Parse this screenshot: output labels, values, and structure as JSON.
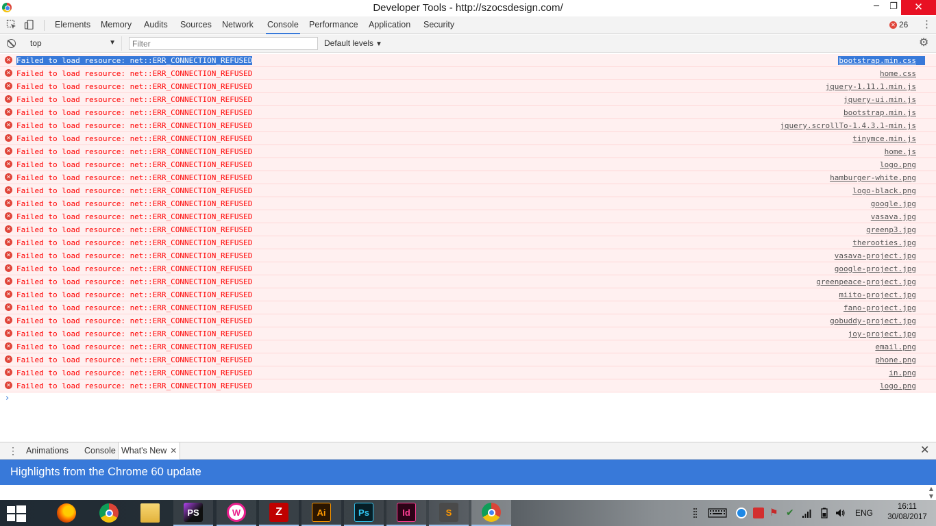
{
  "window": {
    "title": "Developer Tools - http://szocsdesign.com/",
    "min_glyph": "─",
    "max_glyph": "❐",
    "close_glyph": "✕"
  },
  "tabs": [
    "Elements",
    "Memory",
    "Audits",
    "Sources",
    "Network",
    "Console",
    "Performance",
    "Application",
    "Security"
  ],
  "active_tab": "Console",
  "error_count": "26",
  "filterbar": {
    "context": "top",
    "filter_placeholder": "Filter",
    "levels": "Default levels"
  },
  "messages": [
    {
      "text": "Failed to load resource: net::ERR_CONNECTION_REFUSED",
      "source": "bootstrap.min.css",
      "selected": true
    },
    {
      "text": "Failed to load resource: net::ERR_CONNECTION_REFUSED",
      "source": "home.css"
    },
    {
      "text": "Failed to load resource: net::ERR_CONNECTION_REFUSED",
      "source": "jquery-1.11.1.min.js"
    },
    {
      "text": "Failed to load resource: net::ERR_CONNECTION_REFUSED",
      "source": "jquery-ui.min.js"
    },
    {
      "text": "Failed to load resource: net::ERR_CONNECTION_REFUSED",
      "source": "bootstrap.min.js"
    },
    {
      "text": "Failed to load resource: net::ERR_CONNECTION_REFUSED",
      "source": "jquery.scrollTo-1.4.3.1-min.js"
    },
    {
      "text": "Failed to load resource: net::ERR_CONNECTION_REFUSED",
      "source": "tinymce.min.js"
    },
    {
      "text": "Failed to load resource: net::ERR_CONNECTION_REFUSED",
      "source": "home.js"
    },
    {
      "text": "Failed to load resource: net::ERR_CONNECTION_REFUSED",
      "source": "logo.png"
    },
    {
      "text": "Failed to load resource: net::ERR_CONNECTION_REFUSED",
      "source": "hamburger-white.png"
    },
    {
      "text": "Failed to load resource: net::ERR_CONNECTION_REFUSED",
      "source": "logo-black.png"
    },
    {
      "text": "Failed to load resource: net::ERR_CONNECTION_REFUSED",
      "source": "google.jpg"
    },
    {
      "text": "Failed to load resource: net::ERR_CONNECTION_REFUSED",
      "source": "vasava.jpg"
    },
    {
      "text": "Failed to load resource: net::ERR_CONNECTION_REFUSED",
      "source": "greenp3.jpg"
    },
    {
      "text": "Failed to load resource: net::ERR_CONNECTION_REFUSED",
      "source": "therooties.jpg"
    },
    {
      "text": "Failed to load resource: net::ERR_CONNECTION_REFUSED",
      "source": "vasava-project.jpg"
    },
    {
      "text": "Failed to load resource: net::ERR_CONNECTION_REFUSED",
      "source": "google-project.jpg"
    },
    {
      "text": "Failed to load resource: net::ERR_CONNECTION_REFUSED",
      "source": "greenpeace-project.jpg"
    },
    {
      "text": "Failed to load resource: net::ERR_CONNECTION_REFUSED",
      "source": "miito-project.jpg"
    },
    {
      "text": "Failed to load resource: net::ERR_CONNECTION_REFUSED",
      "source": "fano-project.jpg"
    },
    {
      "text": "Failed to load resource: net::ERR_CONNECTION_REFUSED",
      "source": "gobuddy-project.jpg"
    },
    {
      "text": "Failed to load resource: net::ERR_CONNECTION_REFUSED",
      "source": "joy-project.jpg"
    },
    {
      "text": "Failed to load resource: net::ERR_CONNECTION_REFUSED",
      "source": "email.png"
    },
    {
      "text": "Failed to load resource: net::ERR_CONNECTION_REFUSED",
      "source": "phone.png"
    },
    {
      "text": "Failed to load resource: net::ERR_CONNECTION_REFUSED",
      "source": "in.png"
    },
    {
      "text": "Failed to load resource: net::ERR_CONNECTION_REFUSED",
      "source": "logo.png"
    }
  ],
  "prompt_glyph": "›",
  "drawer": {
    "tabs": [
      "Animations",
      "Console",
      "What's New"
    ],
    "active": "What's New",
    "banner": "Highlights from the Chrome 60 update"
  },
  "taskbar": {
    "apps": [
      {
        "icon": "firefox-icon",
        "label": ""
      },
      {
        "icon": "chrome-icon",
        "label": ""
      },
      {
        "icon": "file-explorer-icon",
        "label": ""
      },
      {
        "icon": "phpstorm-icon",
        "label": "PS"
      },
      {
        "icon": "wampserver-icon",
        "label": "W"
      },
      {
        "icon": "filezilla-icon",
        "label": "Z"
      },
      {
        "icon": "illustrator-icon",
        "label": "Ai"
      },
      {
        "icon": "photoshop-icon",
        "label": "Ps"
      },
      {
        "icon": "indesign-icon",
        "label": "Id"
      },
      {
        "icon": "sublime-text-icon",
        "label": "S"
      },
      {
        "icon": "chrome-icon",
        "label": ""
      }
    ],
    "language": "ENG",
    "time": "16:11",
    "date": "30/08/2017"
  },
  "colors": {
    "accent": "#3879d9",
    "error_text": "#ff0000",
    "error_bg": "#fff0f0",
    "close_red": "#e81123"
  }
}
